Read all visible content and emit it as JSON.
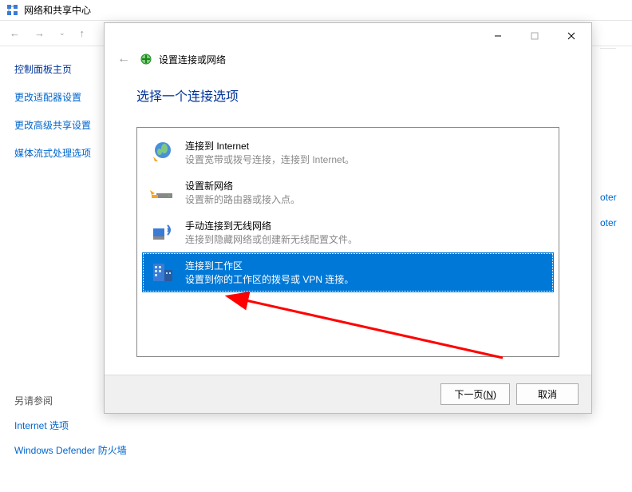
{
  "bg": {
    "title": "网络和共享中心",
    "sidebar": {
      "title": "控制面板主页",
      "links": [
        "更改适配器设置",
        "更改高级共享设置",
        "媒体流式处理选项"
      ]
    },
    "right_partial": [
      "oter",
      "oter"
    ],
    "see_also": {
      "title": "另请参阅",
      "links": [
        "Internet 选项",
        "Windows Defender 防火墙"
      ]
    }
  },
  "modal": {
    "controls": {
      "min": "—",
      "max": "☐",
      "close": "✕"
    },
    "back": "←",
    "header_title": "设置连接或网络",
    "heading": "选择一个连接选项",
    "options": [
      {
        "title": "连接到 Internet",
        "desc": "设置宽带或拨号连接，连接到 Internet。",
        "icon": "globe",
        "selected": false
      },
      {
        "title": "设置新网络",
        "desc": "设置新的路由器或接入点。",
        "icon": "router",
        "selected": false
      },
      {
        "title": "手动连接到无线网络",
        "desc": "连接到隐藏网络或创建新无线配置文件。",
        "icon": "wlan",
        "selected": false
      },
      {
        "title": "连接到工作区",
        "desc": "设置到你的工作区的拨号或 VPN 连接。",
        "icon": "workplace",
        "selected": true
      }
    ],
    "next_label": "下一页(N)",
    "cancel_label": "取消"
  }
}
